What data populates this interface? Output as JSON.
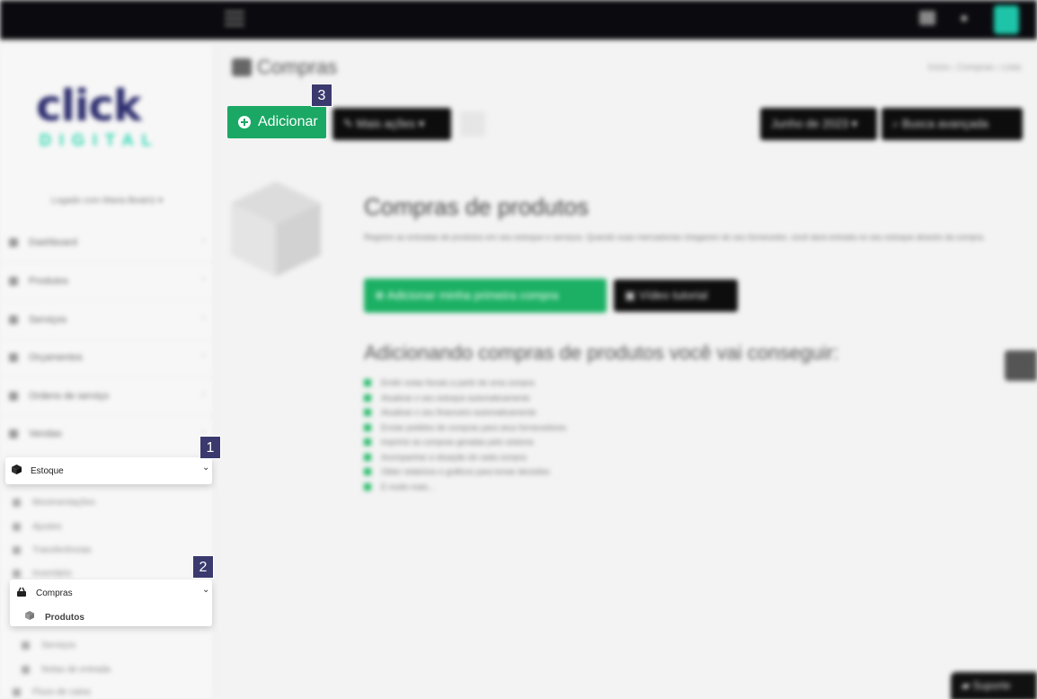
{
  "app": {
    "logo_top": "click",
    "logo_bottom": "DIGITAL",
    "logged_in_text": "Logado com Maria Beatriz ▾"
  },
  "topbar": {
    "menu_icon": "hamburger-icon",
    "notifications_icon": "bell-icon",
    "user_icon": "user-avatar-icon"
  },
  "sidebar": {
    "items": [
      {
        "label": "Dashboard",
        "icon": "home-icon"
      },
      {
        "label": "Produtos",
        "icon": "tag-icon"
      },
      {
        "label": "Serviços",
        "icon": "wrench-icon"
      },
      {
        "label": "Orçamentos",
        "icon": "file-icon"
      },
      {
        "label": "Ordens de serviço",
        "icon": "clipboard-icon"
      },
      {
        "label": "Vendas",
        "icon": "cart-icon"
      }
    ],
    "estoque": {
      "label": "Estoque",
      "icon": "box-icon"
    },
    "estoque_sub": [
      {
        "label": "Movimentações"
      },
      {
        "label": "Ajustes"
      },
      {
        "label": "Transferências"
      },
      {
        "label": "Inventário"
      }
    ],
    "compras": {
      "label": "Compras",
      "icon": "basket-icon",
      "sub_label": "Produtos",
      "sub_icon": "cube-icon"
    },
    "compras_sub": [
      {
        "label": "Serviços"
      },
      {
        "label": "Notas de entrada"
      }
    ],
    "next_item": {
      "label": "Fluxo de caixa"
    }
  },
  "page": {
    "title": "Compras",
    "breadcrumb": "Início › Compras › Lista",
    "add_button": "Adicionar",
    "more_actions": "Mais ações ▾",
    "period_filter": "Junho de 2023 ▾",
    "search_button": "Busca avançada"
  },
  "hero": {
    "title": "Compras de produtos",
    "description": "Registre as entradas de produtos em seu estoque e serviços. Quando suas mercadorias chegarem do seu fornecedor, você dará entrada no seu estoque através da compra.",
    "primary_cta": "Adicionar minha primeira compra",
    "video_cta": "Vídeo tutorial"
  },
  "benefits": {
    "title": "Adicionando compras de produtos você vai conseguir:",
    "items": [
      "Emitir notas fiscais a partir de uma compra",
      "Atualizar o seu estoque automaticamente",
      "Atualizar o seu financeiro automaticamente",
      "Enviar pedidos de compras para seus fornecedores",
      "Imprimir as compras geradas pelo sistema",
      "Acompanhar a situação de cada compra",
      "Obter relatórios e gráficos para tomar decisões",
      "E muito mais..."
    ]
  },
  "support": {
    "label": "Suporte"
  },
  "annotations": {
    "badge1": "1",
    "badge2": "2",
    "badge3": "3"
  },
  "colors": {
    "accent_green": "#1aa864",
    "badge": "#3a3a6e",
    "dark": "#0d0d0d"
  }
}
